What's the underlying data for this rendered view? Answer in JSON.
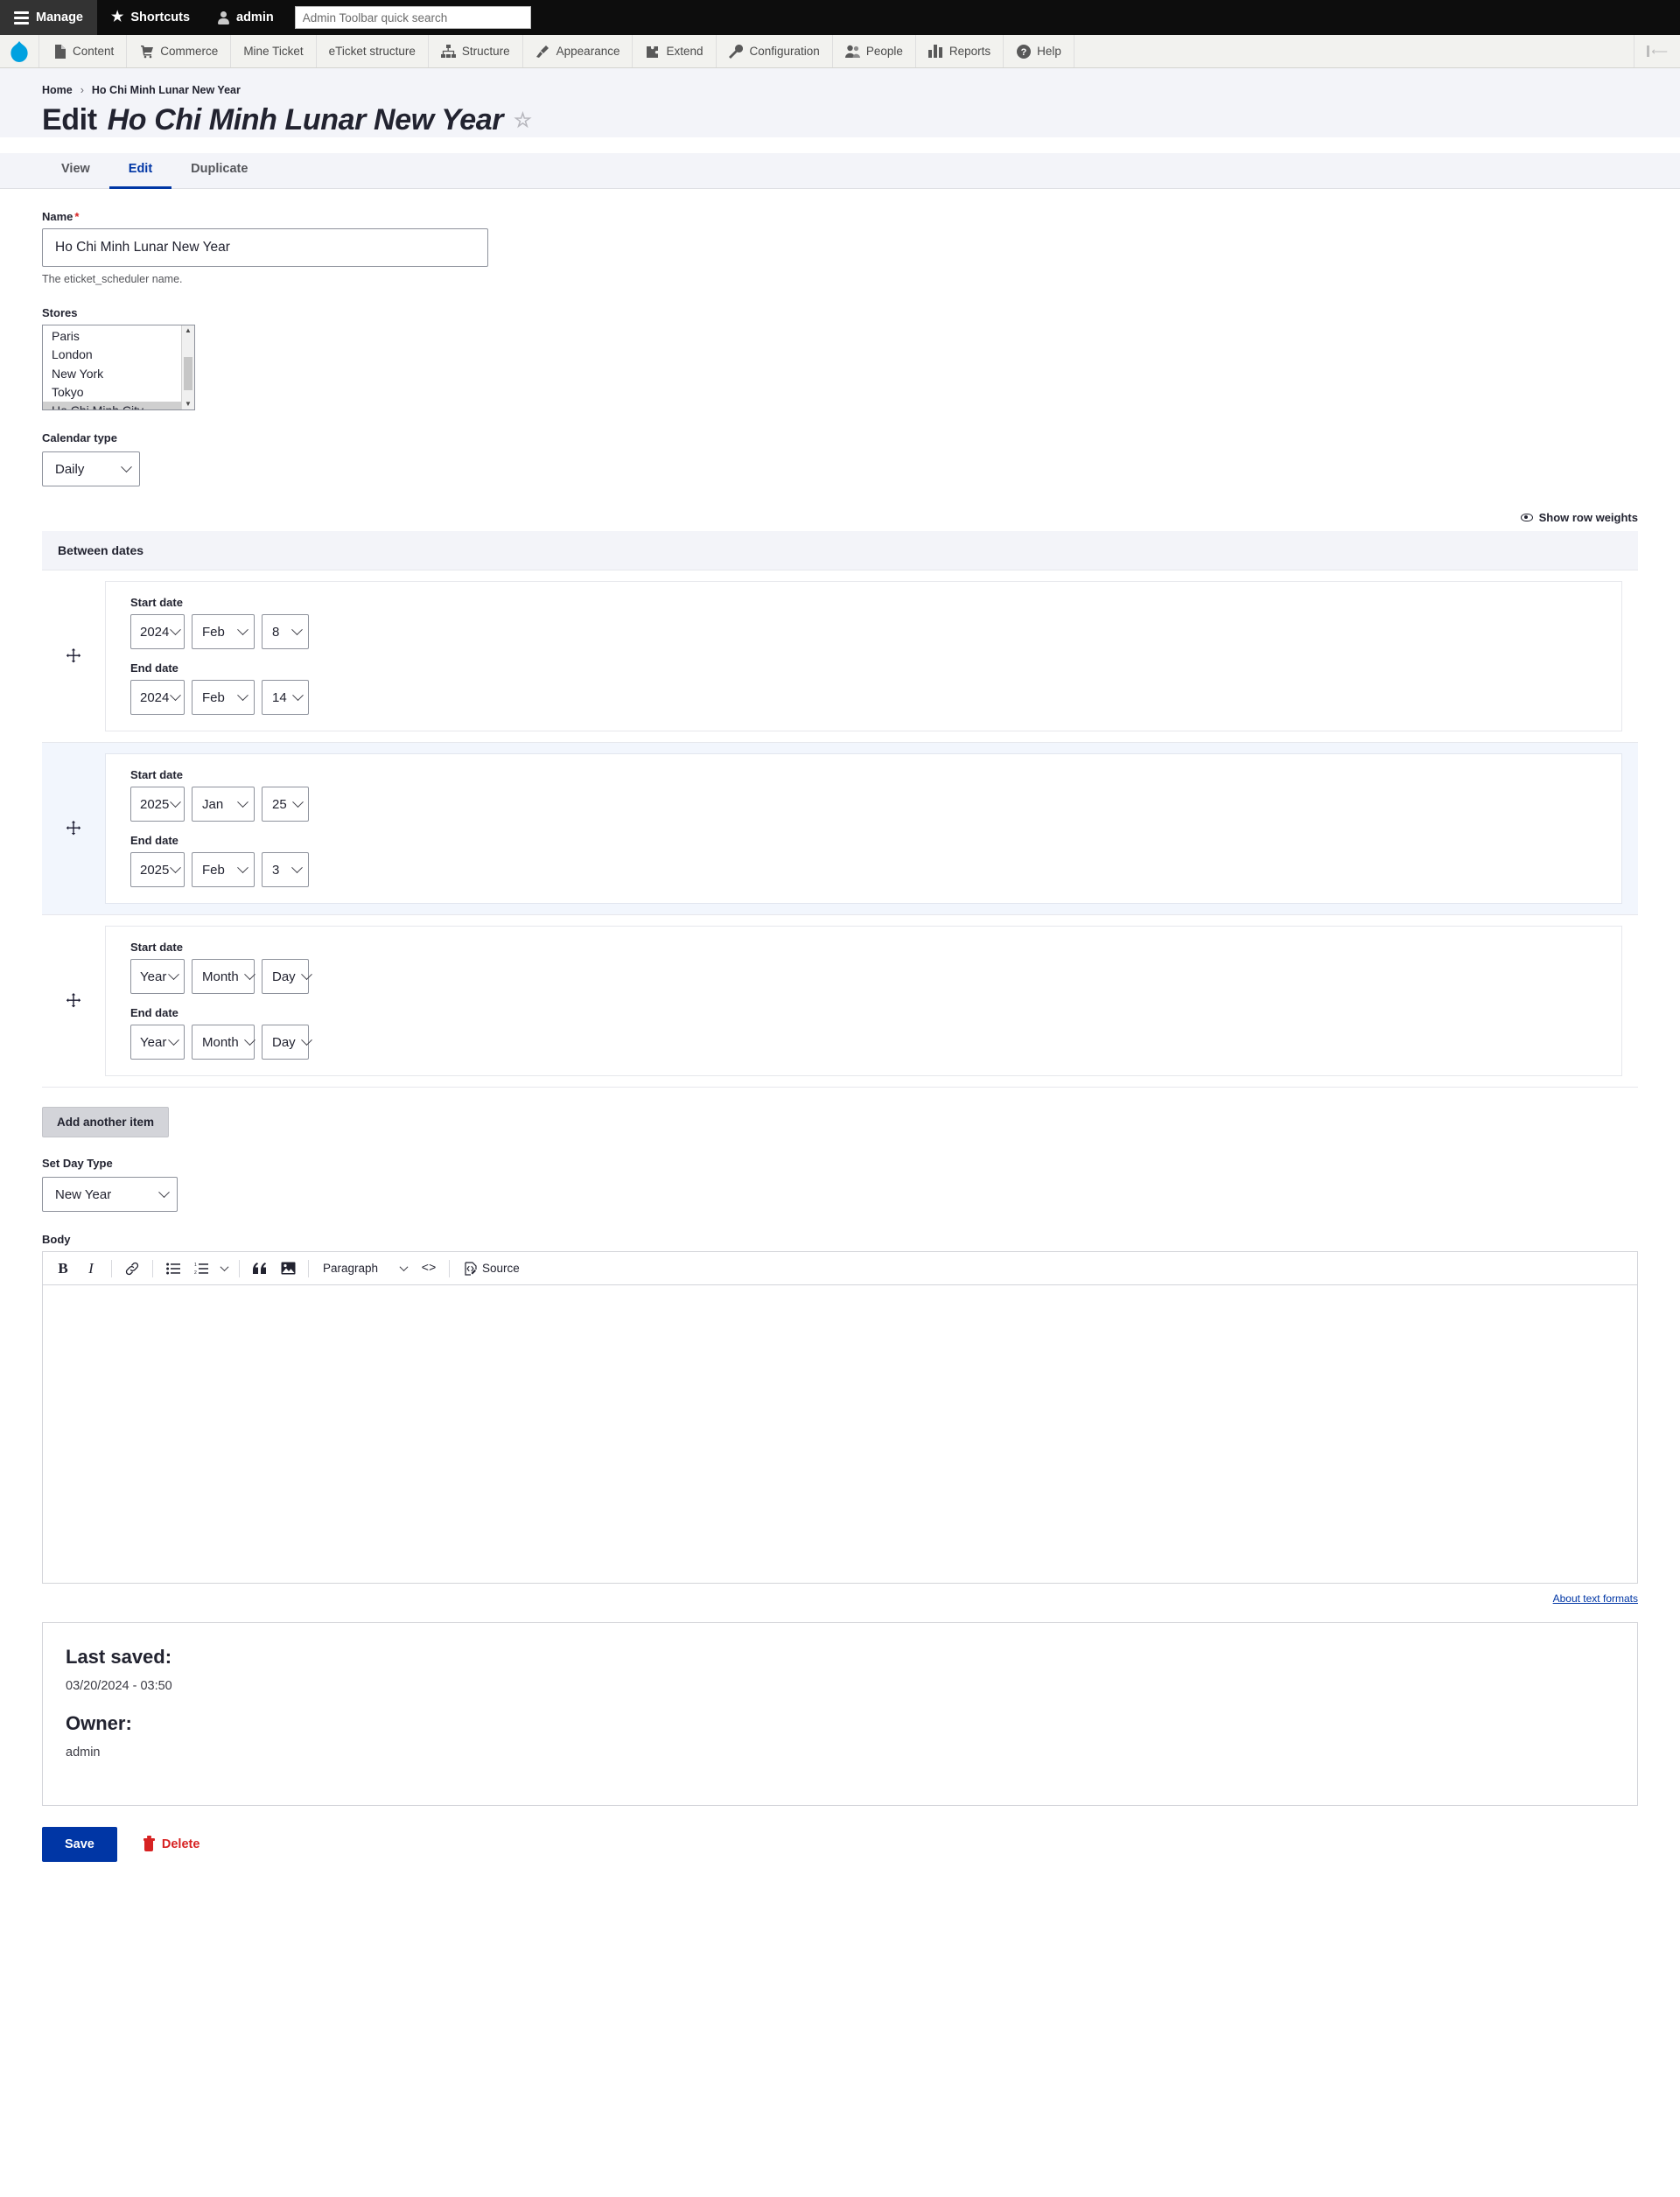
{
  "toolbar": {
    "manage_label": "Manage",
    "shortcuts_label": "Shortcuts",
    "user_label": "admin",
    "search_placeholder": "Admin Toolbar quick search",
    "search_value": ""
  },
  "menu": {
    "items": [
      {
        "label": "Content",
        "icon": "file-icon"
      },
      {
        "label": "Commerce",
        "icon": "cart-icon"
      },
      {
        "label": "Mine Ticket",
        "icon": "none"
      },
      {
        "label": "eTicket structure",
        "icon": "none"
      },
      {
        "label": "Structure",
        "icon": "sitemap-icon"
      },
      {
        "label": "Appearance",
        "icon": "brush-icon"
      },
      {
        "label": "Extend",
        "icon": "puzzle-icon"
      },
      {
        "label": "Configuration",
        "icon": "wrench-icon"
      },
      {
        "label": "People",
        "icon": "people-icon"
      },
      {
        "label": "Reports",
        "icon": "bars-icon"
      },
      {
        "label": "Help",
        "icon": "question-icon"
      }
    ]
  },
  "breadcrumb": {
    "home": "Home",
    "separator": "›",
    "current": "Ho Chi Minh Lunar New Year"
  },
  "page": {
    "title_prefix": "Edit",
    "title_subject": "Ho Chi Minh Lunar New Year",
    "star": "☆"
  },
  "tabs": [
    {
      "label": "View",
      "active": false
    },
    {
      "label": "Edit",
      "active": true
    },
    {
      "label": "Duplicate",
      "active": false
    }
  ],
  "form": {
    "name": {
      "label": "Name",
      "required_mark": "*",
      "value": "Ho Chi Minh Lunar New Year",
      "placeholder": "",
      "description": "The eticket_scheduler name."
    },
    "stores": {
      "label": "Stores",
      "options": [
        "Paris",
        "London",
        "New York",
        "Tokyo",
        "Ho Chi Minh City"
      ],
      "selected": "Ho Chi Minh City"
    },
    "calendar_type": {
      "label": "Calendar type",
      "value": "Daily"
    },
    "row_weights_label": "Show row weights",
    "between_dates": {
      "header": "Between dates",
      "start_label": "Start date",
      "end_label": "End date",
      "rows": [
        {
          "dragging": false,
          "start": {
            "year": "2024",
            "month": "Feb",
            "day": "8"
          },
          "end": {
            "year": "2024",
            "month": "Feb",
            "day": "14"
          }
        },
        {
          "dragging": true,
          "start": {
            "year": "2025",
            "month": "Jan",
            "day": "25"
          },
          "end": {
            "year": "2025",
            "month": "Feb",
            "day": "3"
          }
        },
        {
          "dragging": false,
          "start": {
            "year": "Year",
            "month": "Month",
            "day": "Day"
          },
          "end": {
            "year": "Year",
            "month": "Month",
            "day": "Day"
          }
        }
      ]
    },
    "add_another_label": "Add another item",
    "day_type": {
      "label": "Set Day Type",
      "value": "New Year"
    },
    "body": {
      "label": "Body",
      "content": "",
      "toolbar": {
        "bold": "B",
        "italic": "I",
        "paragraph_style": "Paragraph",
        "source_label": "Source"
      },
      "about_formats": "About text formats"
    }
  },
  "meta": {
    "last_saved_label": "Last saved:",
    "last_saved_value": "03/20/2024 - 03:50",
    "owner_label": "Owner:",
    "owner_value": "admin"
  },
  "actions": {
    "save_label": "Save",
    "delete_label": "Delete"
  },
  "colors": {
    "accent": "#0036a5",
    "danger": "#d72222",
    "toolbar_bg": "#0d0d0d",
    "menu_bg": "#f2f2ef",
    "header_bg": "#f3f4f9",
    "drag_row_bg": "#f2f6fd"
  }
}
